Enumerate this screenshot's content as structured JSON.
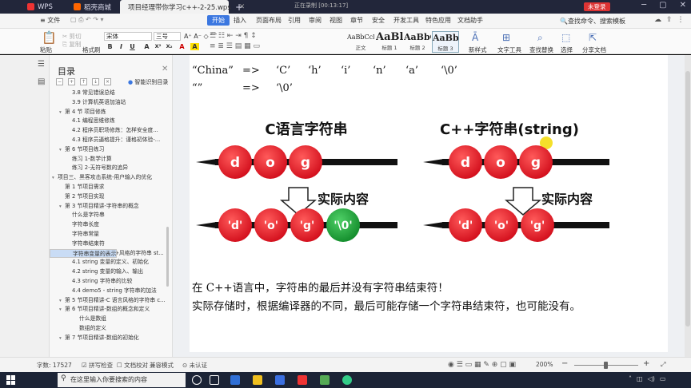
{
  "titlebar": {
    "tabs": [
      {
        "label": "WPS"
      },
      {
        "label": "稻壳商城"
      },
      {
        "label": "项目经理带你学习c++-2-25.wps"
      }
    ],
    "new_tab": "+",
    "recording": "正在录制 [00:13:17]",
    "login": "未登录",
    "window_controls": [
      "─",
      "▢",
      "✕"
    ]
  },
  "menubar": {
    "file": "≡ 文件",
    "items": [
      "开始",
      "插入",
      "页面布局",
      "引用",
      "审阅",
      "视图",
      "章节",
      "安全",
      "开发工具",
      "特色应用",
      "文档助手"
    ],
    "active": "开始",
    "search": "🔍查找命令、搜索模板"
  },
  "ribbon": {
    "paste": "粘贴",
    "cut": "剪切",
    "copy": "复制",
    "format_painter": "格式刷",
    "font_name": "宋体",
    "font_size": "三号",
    "format_buttons": [
      "B",
      "I",
      "U",
      "A",
      "X²",
      "X₂",
      "A",
      "A"
    ],
    "styles": [
      {
        "preview": "AaBbCcDt",
        "label": "正文"
      },
      {
        "preview": "AaBl",
        "label": "标题 1"
      },
      {
        "preview": "AaBbC",
        "label": "标题 2"
      },
      {
        "preview": "AaBbC",
        "label": "标题 3"
      }
    ],
    "new_style": "新样式",
    "text_tool": "文字工具",
    "find_replace": "查找替换",
    "select": "选择",
    "share": "分享文档"
  },
  "nav": {
    "title": "目录",
    "smart_toc": "智能识别目录",
    "items": [
      {
        "text": "3.8 常见错误总结",
        "indent": 3,
        "caret": false,
        "selected": false
      },
      {
        "text": "3.9 计算机英语加油站",
        "indent": 3,
        "caret": false,
        "selected": false
      },
      {
        "text": "第 4 节 项目修炼",
        "indent": 2,
        "caret": true,
        "selected": false
      },
      {
        "text": "4.1 编程思维修炼",
        "indent": 3,
        "caret": false,
        "selected": false
      },
      {
        "text": "4.2 程序员职场修炼：怎样安全度...",
        "indent": 3,
        "caret": false,
        "selected": false
      },
      {
        "text": "4.3 程序员逼格提升：谨格初体验-...",
        "indent": 3,
        "caret": false,
        "selected": false
      },
      {
        "text": "第 6 节项目练习",
        "indent": 2,
        "caret": true,
        "selected": false
      },
      {
        "text": "练习 1-数学计算",
        "indent": 3,
        "caret": false,
        "selected": false
      },
      {
        "text": "练习 2-无符号数的追异",
        "indent": 3,
        "caret": false,
        "selected": false
      },
      {
        "text": "项目三、黑客攻击系统-用户输入的优化",
        "indent": 1,
        "caret": true,
        "selected": false
      },
      {
        "text": "第 1 节项目需求",
        "indent": 2,
        "caret": false,
        "selected": false
      },
      {
        "text": "第 2 节项目实现",
        "indent": 2,
        "caret": false,
        "selected": false
      },
      {
        "text": "第 3 节项目精讲-字符串的概念",
        "indent": 2,
        "caret": true,
        "selected": false
      },
      {
        "text": "什么是字符串",
        "indent": 3,
        "caret": false,
        "selected": false
      },
      {
        "text": "字符串长度",
        "indent": 3,
        "caret": false,
        "selected": false
      },
      {
        "text": "字符串常量",
        "indent": 3,
        "caret": false,
        "selected": false
      },
      {
        "text": "字符串结束符",
        "indent": 3,
        "caret": false,
        "selected": false
      },
      {
        "text": "字符串变量的表示",
        "indent": 3,
        "caret": false,
        "selected": true
      },
      {
        "text": "第 4 节项目精讲-C++风格的字符串 st...",
        "indent": 2,
        "caret": true,
        "selected": false
      },
      {
        "text": "4.1 string 变量的定义、初始化",
        "indent": 3,
        "caret": false,
        "selected": false
      },
      {
        "text": "4.2 string 变量的输入、输出",
        "indent": 3,
        "caret": false,
        "selected": false
      },
      {
        "text": "4.3 string 字符串的比较",
        "indent": 3,
        "caret": false,
        "selected": false
      },
      {
        "text": "4.4 demo5 - string 字符串的加法",
        "indent": 3,
        "caret": false,
        "selected": false
      },
      {
        "text": "第 5 节项目精讲-C 语言风格的字符串 c...",
        "indent": 2,
        "caret": true,
        "selected": false
      },
      {
        "text": "第 6 节项目精讲-数组的概念和定义",
        "indent": 2,
        "caret": true,
        "selected": false
      },
      {
        "text": "什么是数组",
        "indent": 4,
        "caret": false,
        "selected": false
      },
      {
        "text": "数组的定义",
        "indent": 4,
        "caret": false,
        "selected": false
      },
      {
        "text": "第 7 节项目精讲-数组的初始化",
        "indent": 2,
        "caret": true,
        "selected": false
      }
    ]
  },
  "document": {
    "line1": [
      "“China”",
      "=>",
      "‘C’",
      "‘h’",
      "‘i’",
      "‘n’",
      "‘a’",
      "‘\\0’"
    ],
    "line2": [
      "“”",
      "=>",
      "‘\\0’"
    ],
    "diagram": {
      "left_title": "C语言字符串",
      "right_title": "C++字符串(string)",
      "top_left_beads": [
        "d",
        "o",
        "g"
      ],
      "top_right_beads": [
        "d",
        "o",
        "g"
      ],
      "arrow_label": "实际内容",
      "bottom_left_beads": [
        "'d'",
        "'o'",
        "'g'",
        "'\\0'"
      ],
      "bottom_right_beads": [
        "'d'",
        "'o'",
        "'g'"
      ],
      "bead_color": "#e8212f",
      "terminator_color": "#1aa33a",
      "cursor_color": "#f5e02a"
    },
    "para1": "在 C++语言中，字符串的最后并没有字符串结束符！",
    "para2": "实际存储时，根据编译器的不同，最后可能存储一个字符串结束符，也可能没有。"
  },
  "statusbar": {
    "wordcount": "字数: 17527",
    "spellcheck": "☑ 拼写检查",
    "proofread": "☐ 文档校对",
    "compat": "兼容模式",
    "cert": "⊙ 未认证",
    "zoom": "200%",
    "zoom_minus": "−",
    "zoom_plus": "+"
  },
  "taskbar": {
    "search_placeholder": "在这里输入你要搜索的内容"
  },
  "colors": {
    "accent": "#3b77e0",
    "titlebar_bg": "#22263a",
    "login_red": "#d33333"
  }
}
